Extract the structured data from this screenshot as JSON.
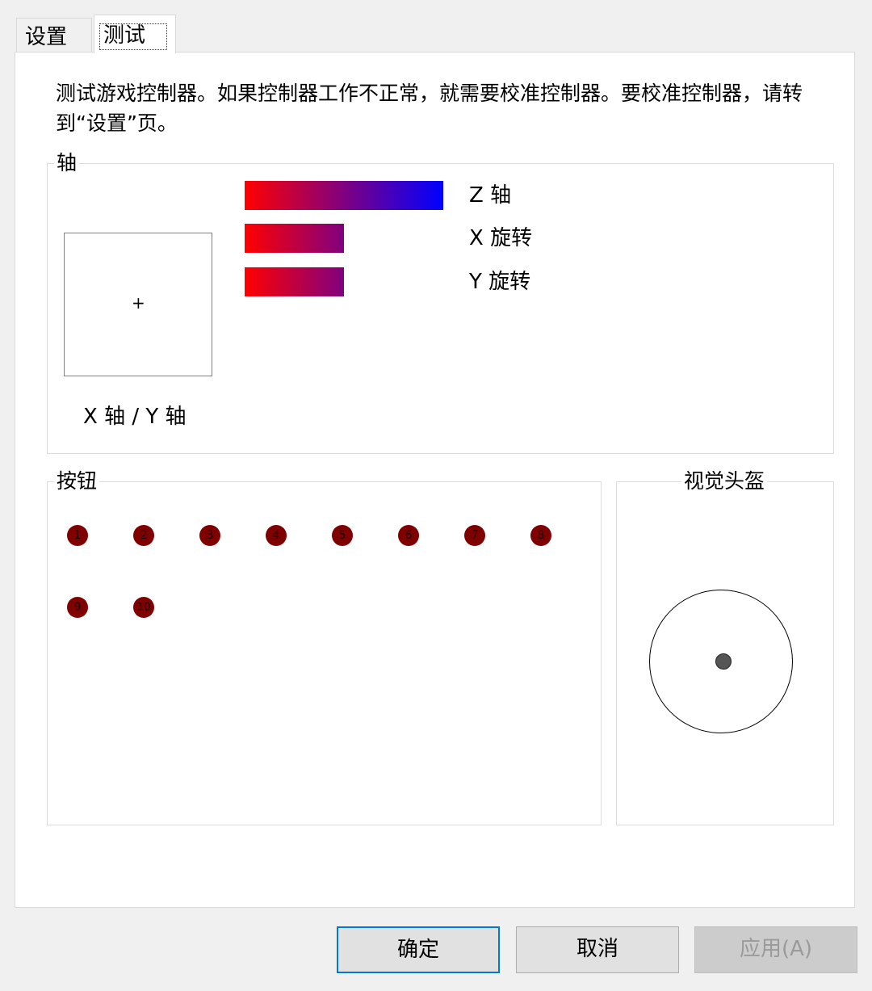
{
  "tabs": [
    {
      "label": "设置",
      "active": false
    },
    {
      "label": "测试",
      "active": true
    }
  ],
  "description": "测试游戏控制器。如果控制器工作不正常，就需要校准控制器。要校准控制器，请转到“设置”页。",
  "axes": {
    "title": "轴",
    "xy_label": "X 轴 / Y 轴",
    "xy_marker": "+",
    "bars": [
      {
        "label": "Z 轴",
        "level": 1.0
      },
      {
        "label": "X 旋转",
        "level": 0.5
      },
      {
        "label": "Y 旋转",
        "level": 0.5
      }
    ]
  },
  "buttons": {
    "title": "按钮",
    "items": [
      "1",
      "2",
      "3",
      "4",
      "5",
      "6",
      "7",
      "8",
      "9",
      "10"
    ],
    "color": "#800000"
  },
  "pov": {
    "title": "视觉头盔"
  },
  "actions": {
    "ok": "确定",
    "cancel": "取消",
    "apply": "应用(A)"
  },
  "colors": {
    "bar_start": "#ff0000",
    "bar_end": "#0000ff",
    "focus": "#0078d7"
  }
}
